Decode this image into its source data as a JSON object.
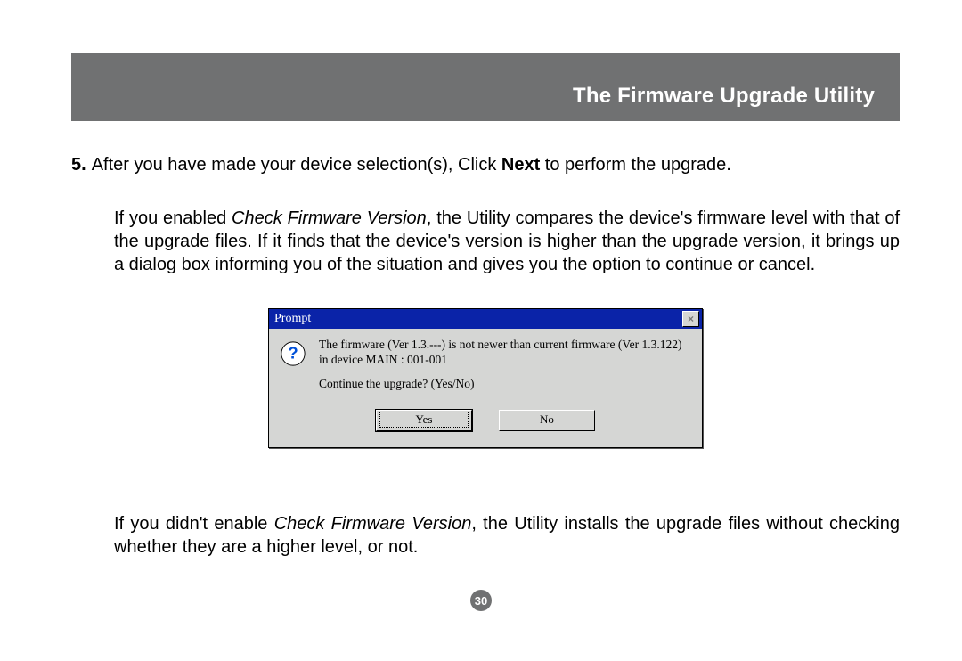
{
  "header": {
    "title": "The Firmware Upgrade Utility"
  },
  "step": {
    "number": "5.",
    "text_before_bold": "After you have made your device selection(s), Click ",
    "bold": "Next",
    "text_after_bold": " to perform the upgrade."
  },
  "para1": {
    "prefix": "If you enabled ",
    "italic": "Check Firmware Version",
    "suffix": ", the Utility compares the device's firmware level with that of the upgrade files. If it finds that the device's version is higher than the upgrade version, it brings up a dialog box informing you of the situation and gives you the option to continue or cancel."
  },
  "dialog": {
    "title": "Prompt",
    "close_glyph": "×",
    "icon": "question-icon",
    "line1": "The firmware (Ver 1.3.---) is not newer than current firmware (Ver 1.3.122) in device MAIN : 001-001",
    "line2": "Continue the upgrade? (Yes/No)",
    "yes": "Yes",
    "no": "No"
  },
  "para2": {
    "prefix": "If you didn't enable ",
    "italic": "Check Firmware Version",
    "suffix": ", the Utility installs the upgrade files without checking whether they are a higher level, or not."
  },
  "page_number": "30"
}
